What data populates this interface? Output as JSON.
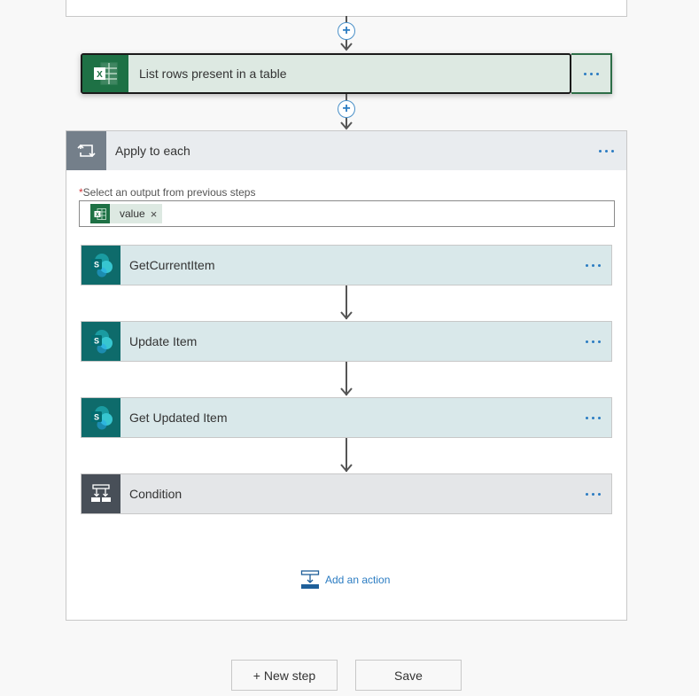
{
  "flow": {
    "excel_step": {
      "title": "List rows present in a table",
      "icon": "excel-icon",
      "connector_icon": "plus-icon"
    },
    "apply_to_each": {
      "title": "Apply to each",
      "icon": "loop-icon",
      "field": {
        "required_marker": "*",
        "label": "Select an output from previous steps",
        "token": {
          "icon": "excel-icon",
          "value": "value",
          "remove": "×"
        }
      },
      "actions": [
        {
          "title": "GetCurrentItem",
          "icon": "sharepoint-icon",
          "type": "sharepoint"
        },
        {
          "title": "Update Item",
          "icon": "sharepoint-icon",
          "type": "sharepoint"
        },
        {
          "title": "Get Updated Item",
          "icon": "sharepoint-icon",
          "type": "sharepoint"
        },
        {
          "title": "Condition",
          "icon": "condition-icon",
          "type": "condition"
        }
      ],
      "add_action_label": "Add an action"
    }
  },
  "footer": {
    "new_step_label": "+ New step",
    "save_label": "Save"
  },
  "colors": {
    "excel_green": "#1e7145",
    "sharepoint_teal": "#0e6b6b",
    "loop_gray": "#747f8a",
    "condition_dark": "#484f58",
    "link_blue": "#2b7cc2",
    "required_red": "#d13438"
  }
}
